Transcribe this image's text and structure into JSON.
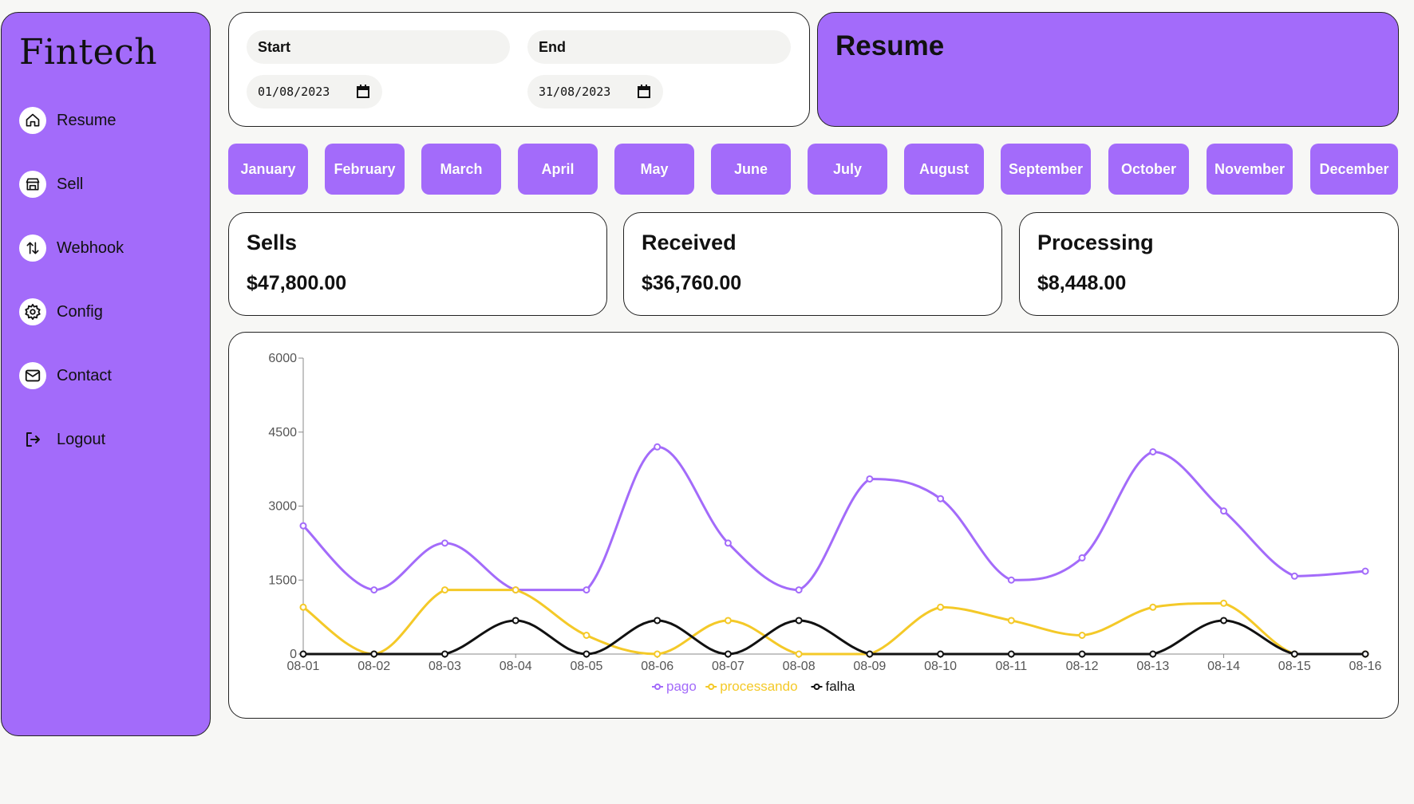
{
  "brand": {
    "name": "Fintech"
  },
  "sidebar": {
    "items": [
      {
        "label": "Resume",
        "icon": "home-icon"
      },
      {
        "label": "Sell",
        "icon": "store-icon"
      },
      {
        "label": "Webhook",
        "icon": "transfer-arrows-icon"
      },
      {
        "label": "Config",
        "icon": "gear-icon"
      },
      {
        "label": "Contact",
        "icon": "mail-icon"
      },
      {
        "label": "Logout",
        "icon": "logout-icon"
      }
    ]
  },
  "filters": {
    "start_label": "Start",
    "start_value": "01/08/2023",
    "end_label": "End",
    "end_value": "31/08/2023"
  },
  "header": {
    "title": "Resume"
  },
  "months": [
    "January",
    "February",
    "March",
    "April",
    "May",
    "June",
    "July",
    "August",
    "September",
    "October",
    "November",
    "December"
  ],
  "stats": [
    {
      "title": "Sells",
      "value": "$47,800.00"
    },
    {
      "title": "Received",
      "value": "$36,760.00"
    },
    {
      "title": "Processing",
      "value": "$8,448.00"
    }
  ],
  "colors": {
    "accent": "#a36bfa",
    "pago": "#a36bfa",
    "processando": "#f4c928",
    "falha": "#111111"
  },
  "chart_data": {
    "type": "line",
    "x": [
      "08-01",
      "08-02",
      "08-03",
      "08-04",
      "08-05",
      "08-06",
      "08-07",
      "08-08",
      "08-09",
      "08-10",
      "08-11",
      "08-12",
      "08-13",
      "08-14",
      "08-15",
      "08-16"
    ],
    "yticks": [
      0,
      1500,
      3000,
      4500,
      6000
    ],
    "ylim": [
      0,
      6000
    ],
    "legend_position": "bottom",
    "series": [
      {
        "name": "pago",
        "values": [
          2600,
          1300,
          2250,
          1300,
          1300,
          4200,
          2250,
          1300,
          3550,
          3150,
          1500,
          1950,
          4100,
          2900,
          1580,
          1680
        ]
      },
      {
        "name": "processando",
        "values": [
          950,
          0,
          1300,
          1300,
          380,
          0,
          680,
          0,
          0,
          950,
          680,
          380,
          950,
          1030,
          0,
          0
        ]
      },
      {
        "name": "falha",
        "values": [
          0,
          0,
          0,
          680,
          0,
          680,
          0,
          680,
          0,
          0,
          0,
          0,
          0,
          680,
          0,
          0
        ]
      }
    ]
  }
}
